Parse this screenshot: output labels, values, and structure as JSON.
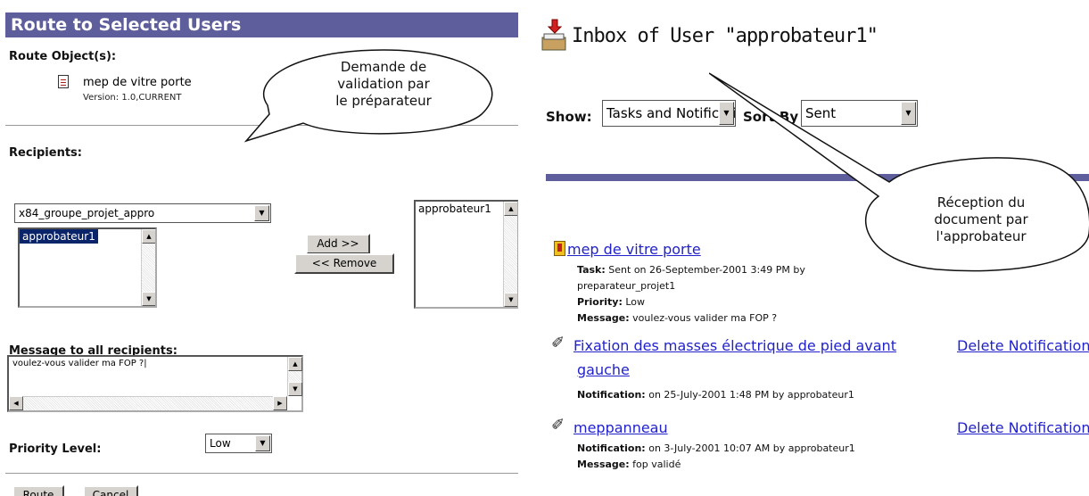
{
  "left": {
    "title": "Route to Selected Users",
    "route_objects_label": "Route Object(s):",
    "object_name": "mep de vitre porte",
    "object_version": "Version: 1.0,CURRENT",
    "recipients_label": "Recipients:",
    "group_select_value": "x84_groupe_projet_appro",
    "available_users": [
      "approbateur1"
    ],
    "add_button": "Add >>",
    "remove_button": "<< Remove",
    "selected_users": [
      "approbateur1"
    ],
    "message_label": "Message to all recipients:",
    "message_value": "voulez-vous valider ma FOP ?|",
    "priority_label": "Priority Level:",
    "priority_value": "Low",
    "route_button": "Route",
    "cancel_button": "Cancel",
    "callout_text": [
      "Demande de",
      "validation par",
      "le préparateur"
    ]
  },
  "right": {
    "title": "Inbox of User \"approbateur1\"",
    "show_label": "Show:",
    "show_value": "Tasks and Notifications",
    "sort_label": "Sort By",
    "sort_value": "Sent",
    "callout_text": [
      "Réception du",
      "document par",
      "l'approbateur"
    ],
    "items": [
      {
        "title": "mep de vitre porte",
        "kind_label": "Task:",
        "kind_value": "Sent on 26-September-2001 3:49 PM by",
        "kind_value_2": "preparateur_projet1",
        "priority_label": "Priority:",
        "priority_value": "Low",
        "message_label": "Message:",
        "message_value": "voulez-vous valider ma FOP ?"
      },
      {
        "title_line1": "Fixation des masses électrique de pied avant",
        "title_line2": "gauche",
        "delete_label": "Delete Notification",
        "kind_label": "Notification:",
        "kind_value": "on 25-July-2001 1:48 PM by approbateur1"
      },
      {
        "title": "meppanneau",
        "delete_label": "Delete Notification",
        "kind_label": "Notification:",
        "kind_value": "on 3-July-2001 10:07 AM by approbateur1",
        "message_label": "Message:",
        "message_value": "fop validé"
      }
    ]
  },
  "colors": {
    "title_bar": "#5e5e9c",
    "link": "#2222cc",
    "selection": "#0a246a"
  },
  "icons": [
    "document-icon",
    "inbox-icon",
    "task-icon",
    "notification-pen-icon",
    "dropdown-arrow-icon",
    "scroll-arrow-icon"
  ]
}
